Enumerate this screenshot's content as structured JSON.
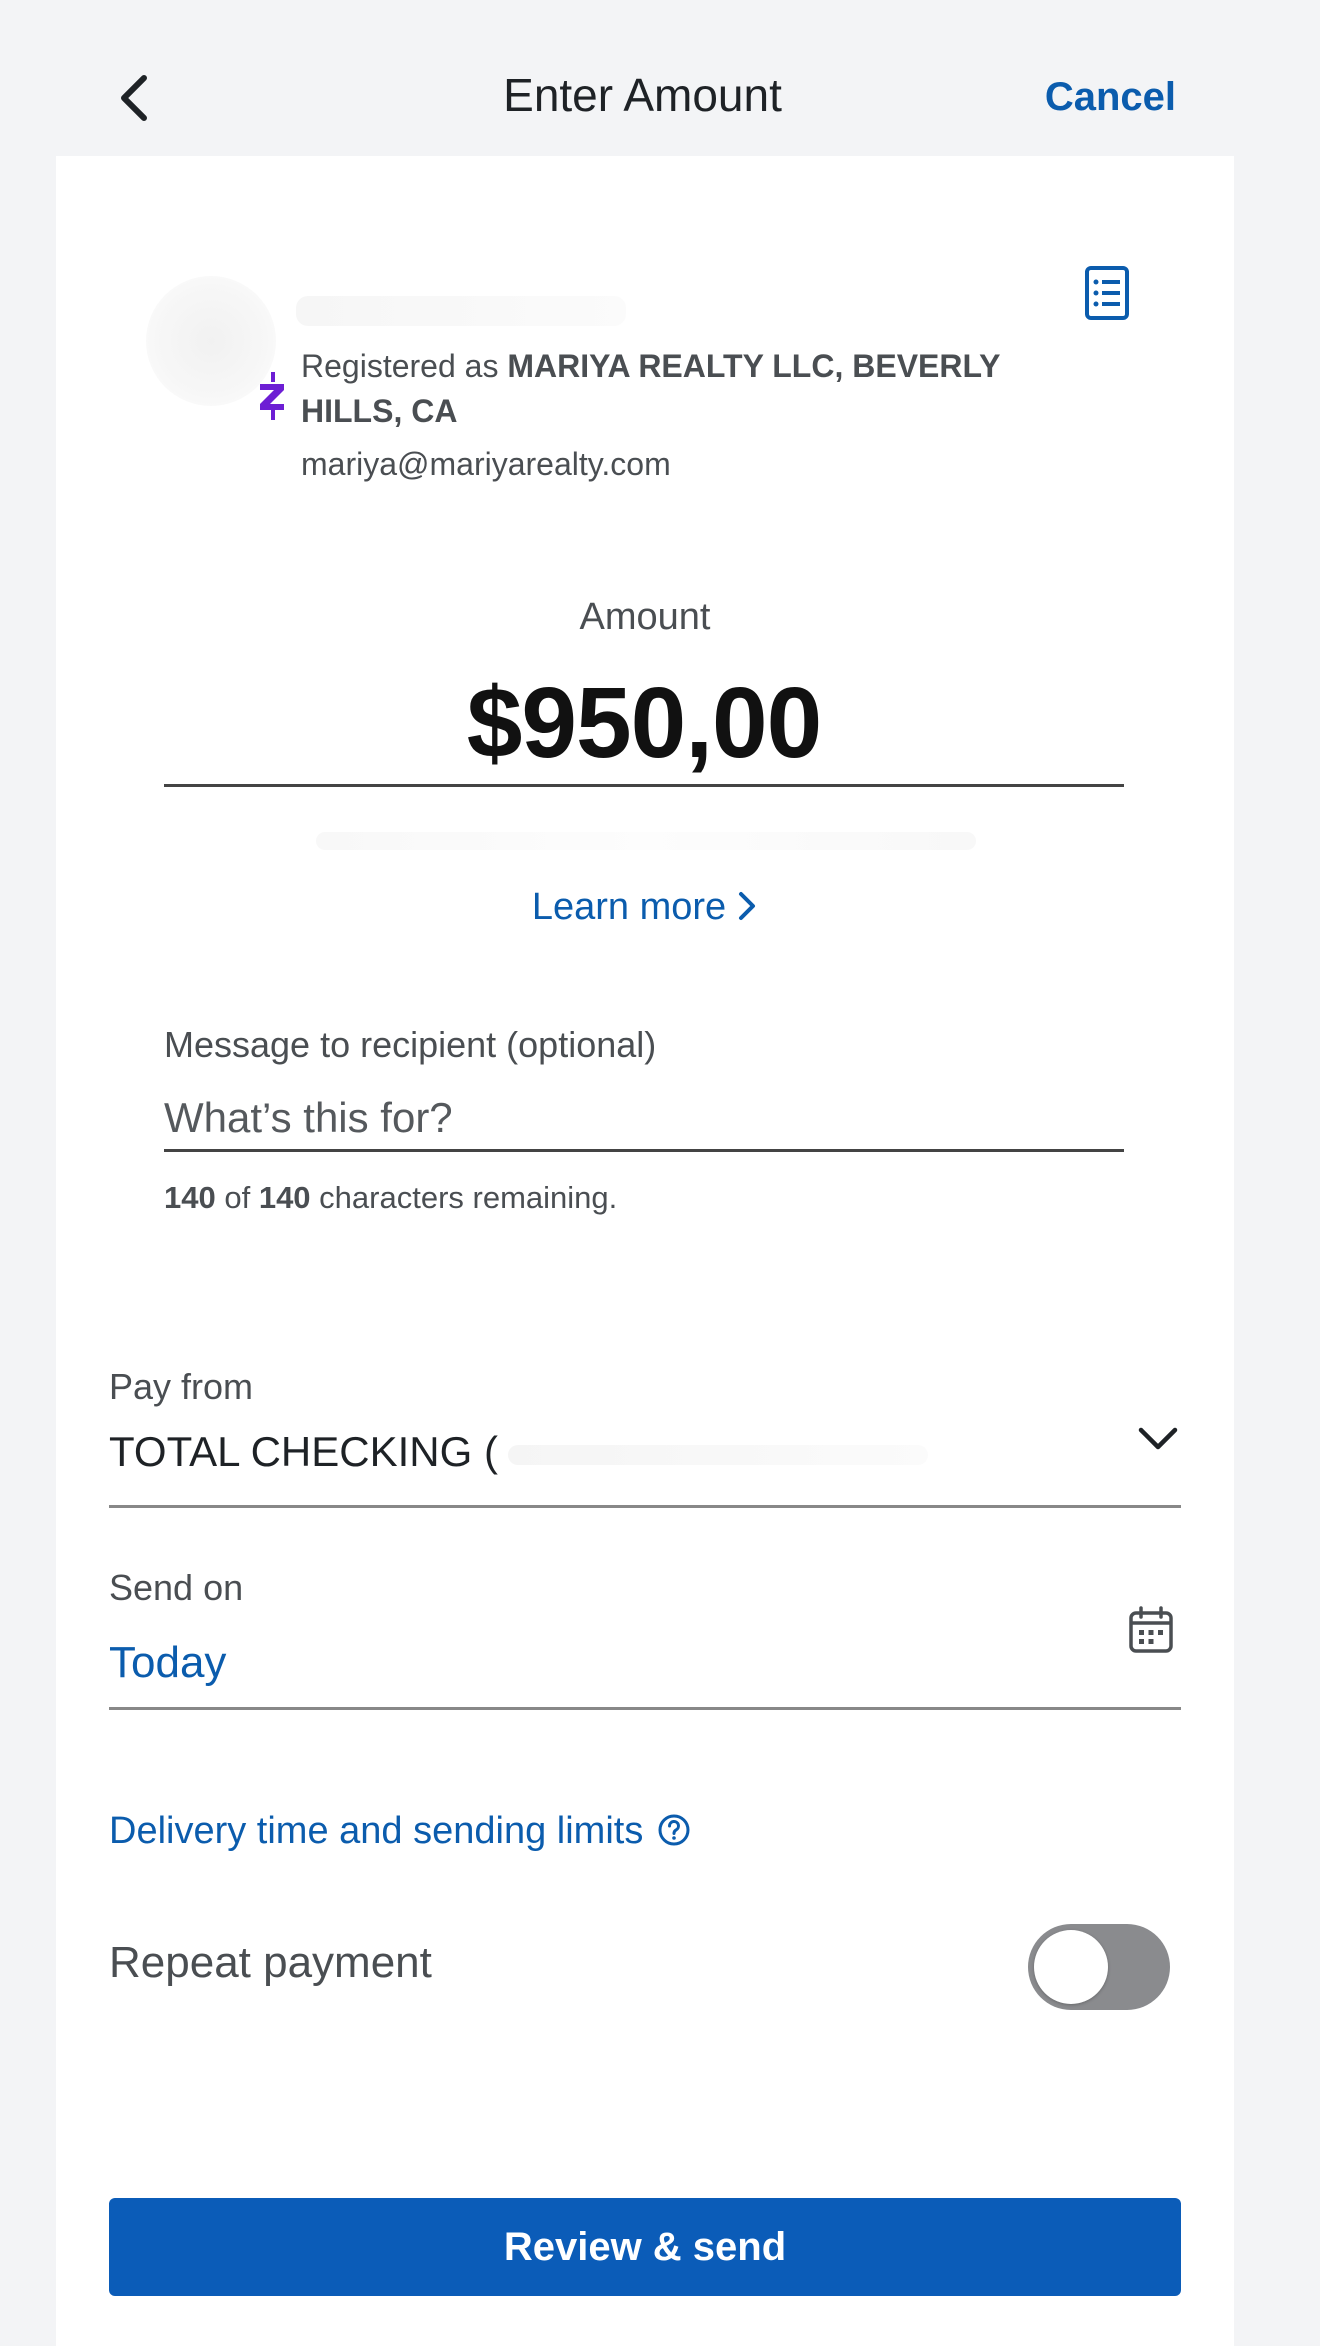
{
  "header": {
    "title": "Enter Amount",
    "cancel_label": "Cancel"
  },
  "recipient": {
    "registered_prefix": "Registered as ",
    "registered_name": "MARIYA REALTY LLC, BEVERLY HILLS, CA",
    "email": "mariya@mariyarealty.com"
  },
  "amount": {
    "label": "Amount",
    "value": "$950,00",
    "learn_more_label": "Learn more"
  },
  "message": {
    "label": "Message to recipient (optional)",
    "placeholder": "What’s this for?",
    "value": "",
    "remaining": "140",
    "max": "140",
    "of_text": " of ",
    "suffix": " characters remaining."
  },
  "pay_from": {
    "label": "Pay from",
    "value": "TOTAL CHECKING ("
  },
  "send_on": {
    "label": "Send on",
    "value": "Today"
  },
  "delivery_link_label": "Delivery time and sending limits",
  "repeat": {
    "label": "Repeat payment",
    "enabled": false
  },
  "primary_button": {
    "label": "Review & send"
  },
  "colors": {
    "accent": "#0b5cad",
    "button": "#0b5cb8",
    "zelle": "#6d1ed4",
    "toggle_off": "#8a8b8e"
  },
  "icons": [
    "back-arrow-icon",
    "details-list-icon",
    "zelle-icon",
    "chevron-right-icon",
    "chevron-down-icon",
    "calendar-icon",
    "help-icon"
  ]
}
